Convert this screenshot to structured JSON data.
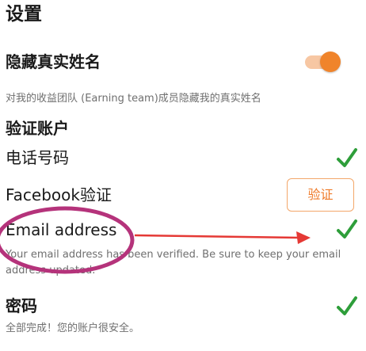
{
  "header": {
    "title": "设置"
  },
  "hide_name": {
    "label": "隐藏真实姓名",
    "description": "对我的收益团队 (Earning team)成员隐藏我的真实姓名",
    "toggle_on": true
  },
  "verify_section": {
    "heading": "验证账户",
    "phone": {
      "label": "电话号码",
      "verified": true
    },
    "facebook": {
      "label": "Facebook验证",
      "button_label": "验证"
    },
    "email": {
      "label": "Email address",
      "description_line1": "Your email address has been verified. Be sure to keep your email",
      "description_line2": "address updated.",
      "verified": true
    }
  },
  "password": {
    "label": "密码",
    "description": "全部完成！您的账户很安全。",
    "verified": true
  },
  "colors": {
    "accent_orange": "#f0842b",
    "check_green": "#2e9e3a",
    "annotation_magenta": "#b5337b",
    "annotation_red": "#e53935"
  },
  "icons": {
    "check": "check-icon",
    "toggle": "toggle-switch"
  }
}
